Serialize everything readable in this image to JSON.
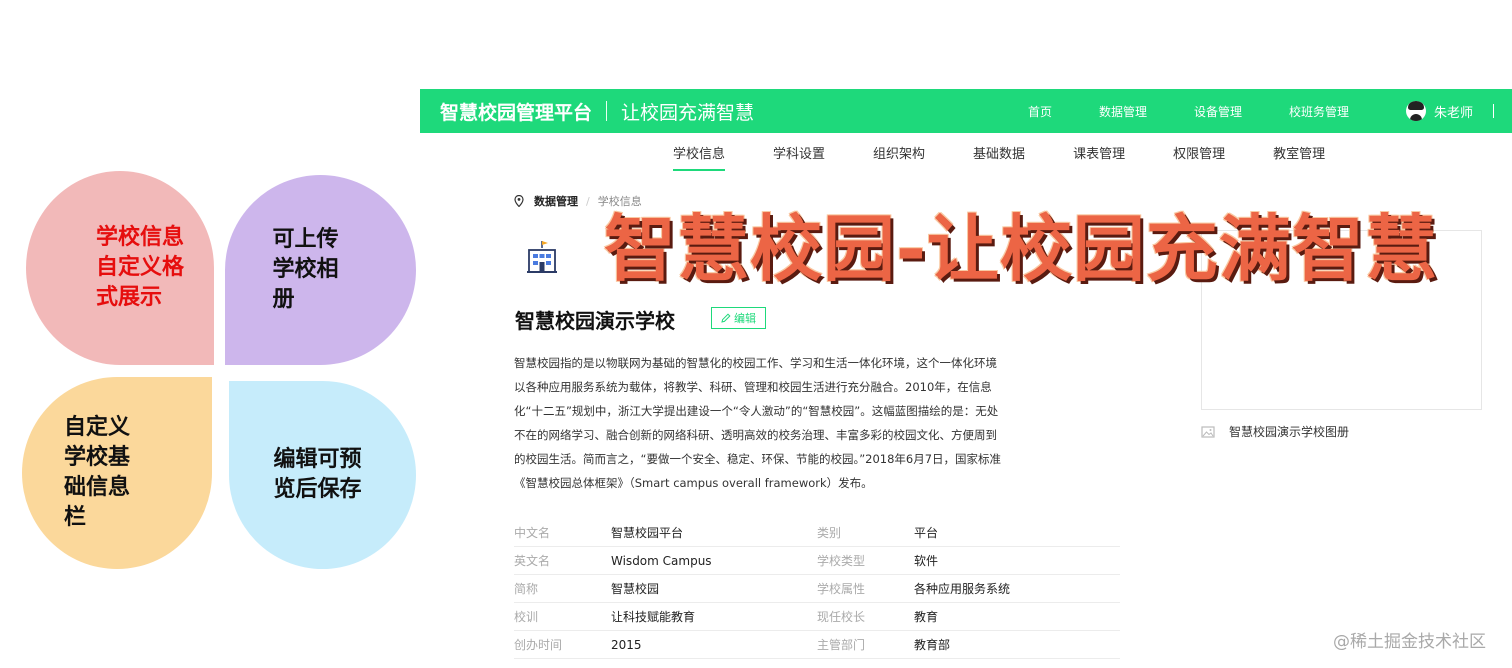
{
  "petals": {
    "p1": "学校信息\n自定义格\n式展示",
    "p2": "可上传\n学校相\n册",
    "p3": "自定义\n学校基\n础信息\n栏",
    "p4": "编辑可预\n览后保存"
  },
  "header": {
    "brand": "智慧校园管理平台",
    "slogan": "让校园充满智慧",
    "nav": [
      "首页",
      "数据管理",
      "设备管理",
      "校班务管理"
    ],
    "user": "朱老师"
  },
  "subnav": [
    "学校信息",
    "学科设置",
    "组织架构",
    "基础数据",
    "课表管理",
    "权限管理",
    "教室管理"
  ],
  "breadcrumb": [
    "数据管理",
    "学校信息"
  ],
  "overlay_title": "智慧校园-让校园充满智慧",
  "school": {
    "name": "智慧校园演示学校",
    "edit_label": "编辑"
  },
  "description": [
    "智慧校园指的是以物联网为基础的智慧化的校园工作、学习和生活一体化环境，这个一体化环境",
    "以各种应用服务系统为载体，将教学、科研、管理和校园生活进行充分融合。2010年，在信息",
    "化“十二五”规划中，浙江大学提出建设一个“令人激动”的“智慧校园”。这幅蓝图描绘的是：无处",
    "不在的网络学习、融合创新的网络科研、透明高效的校务治理、丰富多彩的校园文化、方便周到",
    "的校园生活。简而言之，“要做一个安全、稳定、环保、节能的校园。”2018年6月7日，国家标准",
    "《智慧校园总体框架》（Smart campus overall framework）发布。"
  ],
  "info": [
    {
      "label": "中文名",
      "value": "智慧校园平台",
      "label2": "类别",
      "value2": "平台"
    },
    {
      "label": "英文名",
      "value": "Wisdom Campus",
      "label2": "学校类型",
      "value2": "软件"
    },
    {
      "label": "简称",
      "value": "智慧校园",
      "label2": "学校属性",
      "value2": "各种应用服务系统"
    },
    {
      "label": "校训",
      "value": "让科技赋能教育",
      "label2": "现任校长",
      "value2": "教育"
    },
    {
      "label": "创办时间",
      "value": "2015",
      "label2": "主管部门",
      "value2": "教育部"
    }
  ],
  "album": {
    "label": "智慧校园演示学校图册"
  },
  "watermark": "@稀土掘金技术社区",
  "colors": {
    "primary": "#1ed97b",
    "overlay": "#ec6545"
  }
}
